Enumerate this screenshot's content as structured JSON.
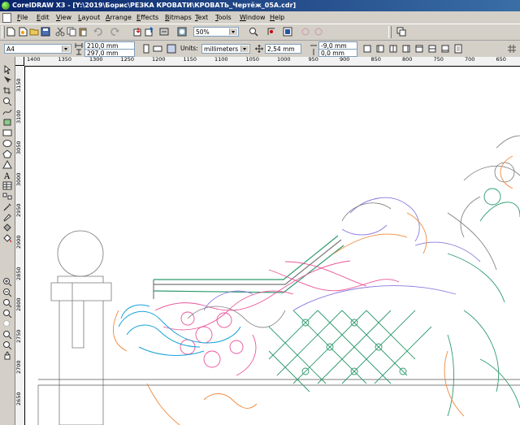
{
  "window": {
    "title": "CorelDRAW X3 - [Y:\\2019\\Борис\\РЕЗКА КРОВАТИ\\КРОВАТЬ_Чертёж_05А.cdr]"
  },
  "menu": {
    "items": [
      "File",
      "Edit",
      "View",
      "Layout",
      "Arrange",
      "Effects",
      "Bitmaps",
      "Text",
      "Tools",
      "Window",
      "Help"
    ]
  },
  "standard_toolbar": {
    "zoom_value": "50%"
  },
  "property_bar": {
    "paper_type": "A4",
    "page_width": "210,0 mm",
    "page_height": "297,0 mm",
    "units_label": "Units:",
    "units_value": "millimeters",
    "nudge_value": "2,54 mm",
    "duplicate_x": "-9,0 mm",
    "duplicate_y": "0,0 mm"
  },
  "rulers": {
    "horizontal_ticks": [
      "1400",
      "1350",
      "1300",
      "1250",
      "1200",
      "1150",
      "1100",
      "1050",
      "1000",
      "950",
      "900",
      "850",
      "800",
      "750",
      "700",
      "650"
    ],
    "vertical_ticks": [
      "3150",
      "3100",
      "3050",
      "3000",
      "2950",
      "2900",
      "2850",
      "2800",
      "2750",
      "2700",
      "2650"
    ]
  },
  "colors": {
    "outline_pink": "#e8559a",
    "outline_green": "#2e9a6e",
    "outline_orange": "#f08a3c",
    "outline_purple": "#8a7adf",
    "outline_cyan": "#1aa3d9",
    "outline_gray": "#777777"
  }
}
